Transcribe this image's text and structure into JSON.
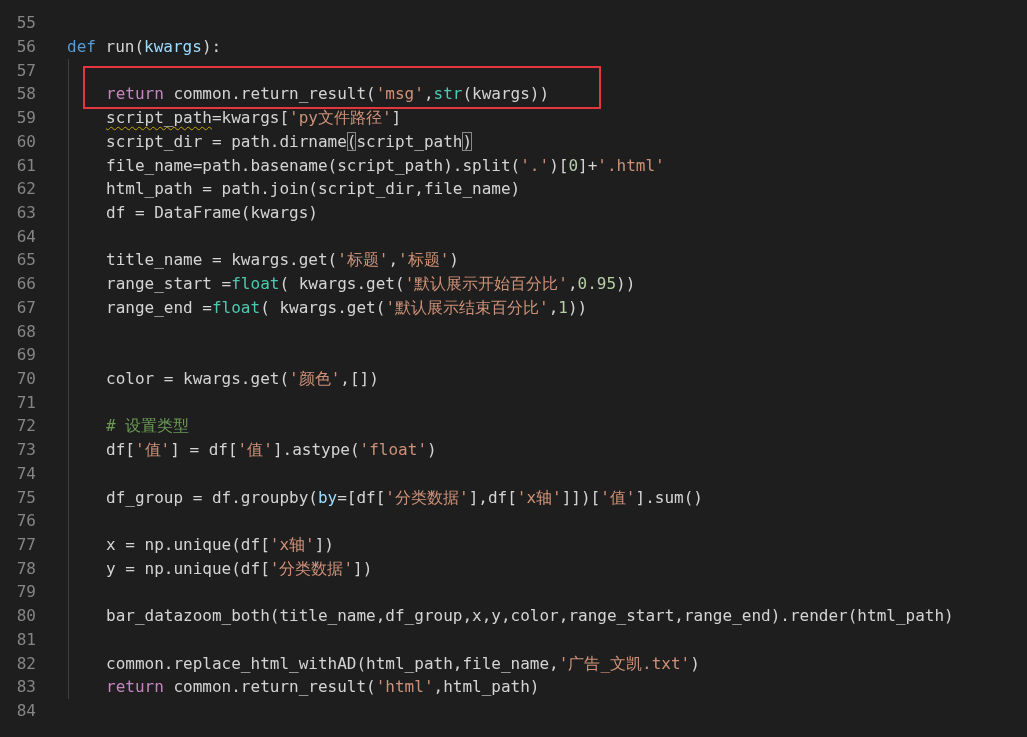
{
  "editor": {
    "lines": [
      {
        "kind": "line",
        "number": "55",
        "boxed": false
      },
      {
        "kind": "line",
        "number": "56",
        "boxed": false,
        "tokens": [
          {
            "kind": "keyword",
            "text": "def"
          },
          {
            "kind": "plain",
            "text": " run("
          },
          {
            "kind": "param",
            "text": "kwargs"
          },
          {
            "kind": "plain",
            "text": "):"
          }
        ],
        "children": [
          {
            "number": "57",
            "boxed": false
          },
          {
            "number": "58",
            "boxed": true,
            "tokens": [
              {
                "kind": "control",
                "text": "return"
              },
              {
                "kind": "plain",
                "text": " common.return_result("
              },
              {
                "kind": "string",
                "text": "'msg'"
              },
              {
                "kind": "plain",
                "text": ","
              },
              {
                "kind": "builtin",
                "text": "str"
              },
              {
                "kind": "plain",
                "text": "(kwargs))"
              }
            ]
          },
          {
            "number": "59",
            "boxed": false,
            "tokens": [
              {
                "kind": "plain",
                "text": "script_path",
                "warning": true
              },
              {
                "kind": "plain",
                "text": "=kwargs[",
                "warning": false
              },
              {
                "kind": "string",
                "text": "'py文件路径'",
                "warning": false
              },
              {
                "kind": "plain",
                "text": "]",
                "warning": false
              }
            ]
          },
          {
            "number": "60",
            "boxed": false,
            "tokens": [
              {
                "kind": "plain",
                "text": "script_dir = path.dirname",
                "matched": false
              },
              {
                "kind": "plain",
                "text": "(",
                "matched": true
              },
              {
                "kind": "plain",
                "text": "script_path",
                "matched": false
              },
              {
                "kind": "plain",
                "text": ")",
                "matched": true
              }
            ]
          },
          {
            "number": "61",
            "boxed": false,
            "tokens": [
              {
                "kind": "plain",
                "text": "file_name=path.basename(script_path).split("
              },
              {
                "kind": "string",
                "text": "'.'"
              },
              {
                "kind": "plain",
                "text": ")["
              },
              {
                "kind": "number",
                "text": "0"
              },
              {
                "kind": "plain",
                "text": "]+"
              },
              {
                "kind": "string",
                "text": "'.html'"
              }
            ]
          },
          {
            "number": "62",
            "boxed": false,
            "tokens": [
              {
                "kind": "plain",
                "text": "html_path = path.join(script_dir,file_name)"
              }
            ]
          },
          {
            "number": "63",
            "boxed": false,
            "tokens": [
              {
                "kind": "plain",
                "text": "df = DataFrame(kwargs)"
              }
            ]
          },
          {
            "number": "64",
            "boxed": false
          },
          {
            "number": "65",
            "boxed": false,
            "tokens": [
              {
                "kind": "plain",
                "text": "title_name = kwargs.get("
              },
              {
                "kind": "string",
                "text": "'标题'"
              },
              {
                "kind": "plain",
                "text": ","
              },
              {
                "kind": "string",
                "text": "'标题'"
              },
              {
                "kind": "plain",
                "text": ")"
              }
            ]
          },
          {
            "number": "66",
            "boxed": false,
            "tokens": [
              {
                "kind": "plain",
                "text": "range_start ="
              },
              {
                "kind": "builtin",
                "text": "float"
              },
              {
                "kind": "plain",
                "text": "( kwargs.get("
              },
              {
                "kind": "string",
                "text": "'默认展示开始百分比'"
              },
              {
                "kind": "plain",
                "text": ","
              },
              {
                "kind": "number",
                "text": "0.95"
              },
              {
                "kind": "plain",
                "text": "))"
              }
            ]
          },
          {
            "number": "67",
            "boxed": false,
            "tokens": [
              {
                "kind": "plain",
                "text": "range_end ="
              },
              {
                "kind": "builtin",
                "text": "float"
              },
              {
                "kind": "plain",
                "text": "( kwargs.get("
              },
              {
                "kind": "string",
                "text": "'默认展示结束百分比'"
              },
              {
                "kind": "plain",
                "text": ","
              },
              {
                "kind": "number",
                "text": "1"
              },
              {
                "kind": "plain",
                "text": "))"
              }
            ]
          },
          {
            "number": "68",
            "boxed": false
          },
          {
            "number": "69",
            "boxed": false
          },
          {
            "number": "70",
            "boxed": false,
            "tokens": [
              {
                "kind": "plain",
                "text": "color = kwargs.get("
              },
              {
                "kind": "string",
                "text": "'颜色'"
              },
              {
                "kind": "plain",
                "text": ",[])"
              }
            ]
          },
          {
            "number": "71",
            "boxed": false
          },
          {
            "number": "72",
            "boxed": false,
            "tokens": [
              {
                "kind": "comment",
                "text": "# 设置类型"
              }
            ]
          },
          {
            "number": "73",
            "boxed": false,
            "tokens": [
              {
                "kind": "plain",
                "text": "df["
              },
              {
                "kind": "string",
                "text": "'值'"
              },
              {
                "kind": "plain",
                "text": "] = df["
              },
              {
                "kind": "string",
                "text": "'值'"
              },
              {
                "kind": "plain",
                "text": "].astype("
              },
              {
                "kind": "string",
                "text": "'float'"
              },
              {
                "kind": "plain",
                "text": ")"
              }
            ]
          },
          {
            "number": "74",
            "boxed": false
          },
          {
            "number": "75",
            "boxed": false,
            "tokens": [
              {
                "kind": "plain",
                "text": "df_group = df.groupby("
              },
              {
                "kind": "param",
                "text": "by"
              },
              {
                "kind": "plain",
                "text": "=[df["
              },
              {
                "kind": "string",
                "text": "'分类数据'"
              },
              {
                "kind": "plain",
                "text": "],df["
              },
              {
                "kind": "string",
                "text": "'x轴'"
              },
              {
                "kind": "plain",
                "text": "]])["
              },
              {
                "kind": "string",
                "text": "'值'"
              },
              {
                "kind": "plain",
                "text": "].sum()"
              }
            ]
          },
          {
            "number": "76",
            "boxed": false
          },
          {
            "number": "77",
            "boxed": false,
            "tokens": [
              {
                "kind": "plain",
                "text": "x = np.unique(df["
              },
              {
                "kind": "string",
                "text": "'x轴'"
              },
              {
                "kind": "plain",
                "text": "])"
              }
            ]
          },
          {
            "number": "78",
            "boxed": false,
            "tokens": [
              {
                "kind": "plain",
                "text": "y = np.unique(df["
              },
              {
                "kind": "string",
                "text": "'分类数据'"
              },
              {
                "kind": "plain",
                "text": "])"
              }
            ]
          },
          {
            "number": "79",
            "boxed": false
          },
          {
            "number": "80",
            "boxed": false,
            "tokens": [
              {
                "kind": "plain",
                "text": "bar_datazoom_both(title_name,df_group,x,y,color,range_start,range_end).render(html_path)"
              }
            ]
          },
          {
            "number": "81",
            "boxed": false
          },
          {
            "number": "82",
            "boxed": false,
            "tokens": [
              {
                "kind": "plain",
                "text": "common.replace_html_withAD(html_path,file_name,"
              },
              {
                "kind": "string",
                "text": "'广告_文凯.txt'"
              },
              {
                "kind": "plain",
                "text": ")"
              }
            ]
          },
          {
            "number": "83",
            "boxed": false,
            "tokens": [
              {
                "kind": "control",
                "text": "return"
              },
              {
                "kind": "plain",
                "text": " common.return_result("
              },
              {
                "kind": "string",
                "text": "'html'"
              },
              {
                "kind": "plain",
                "text": ",html_path)"
              }
            ]
          }
        ]
      },
      {
        "kind": "line",
        "number": "84",
        "boxed": false
      }
    ]
  }
}
